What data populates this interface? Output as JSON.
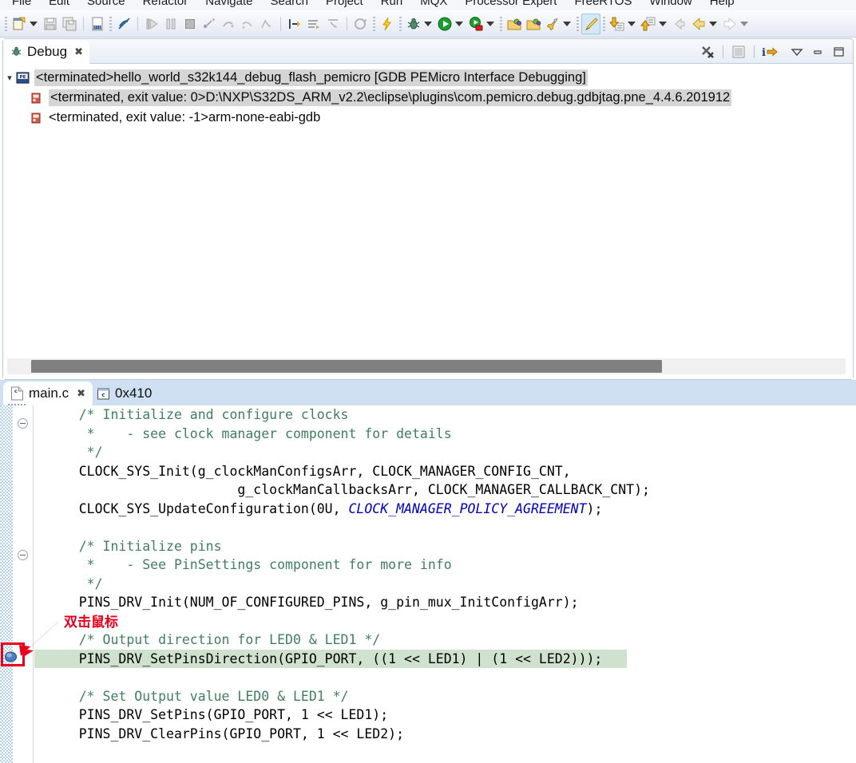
{
  "menu": {
    "items": [
      "File",
      "Edit",
      "Source",
      "Refactor",
      "Navigate",
      "Search",
      "Project",
      "Run",
      "MQX",
      "Processor Expert",
      "FreeRTOS",
      "Window",
      "Help"
    ]
  },
  "toolbar": {
    "icons": [
      "new-file-icon",
      "new-dropdown-caret",
      "save-icon",
      "save-all-icon",
      "build-hex-icon",
      "toggle-link-icon",
      "resume-icon",
      "suspend-icon",
      "terminate-icon",
      "step-into-icon",
      "step-over-icon",
      "step-return-icon",
      "step-instruction-icon",
      "skip-to-line-icon",
      "show-disassembly-icon",
      "instruction-stepping-icon",
      "build-all-icon",
      "build-flash-icon",
      "debug-bug-icon",
      "debug-dropdown-caret",
      "run-icon",
      "run-dropdown-caret",
      "profile-icon",
      "profile-dropdown-caret",
      "open-type-icon",
      "open-resource-icon",
      "launch-icon",
      "launch-dropdown-caret",
      "edit-highlight-icon",
      "next-annotation-icon",
      "next-annotation-caret",
      "previous-annotation-icon",
      "previous-annotation-caret",
      "back-history-icon",
      "back-icon",
      "back-caret",
      "forward-icon",
      "forward-caret"
    ]
  },
  "debug_view": {
    "tab_label": "Debug",
    "tab_icon": "debug-bug-icon",
    "close_icon": "close-icon",
    "tools": [
      {
        "name": "remove-all-terminated-icon",
        "label": "Remove All Terminated Launches"
      },
      {
        "name": "collapse-all-icon",
        "label": "Collapse All"
      },
      {
        "name": "show-details-icon",
        "label": "Show Debug Details"
      },
      {
        "name": "view-menu-icon",
        "label": "View Menu"
      },
      {
        "name": "minimize-icon",
        "label": "Minimize"
      },
      {
        "name": "maximize-icon",
        "label": "Maximize"
      }
    ],
    "tree": {
      "root": {
        "expander": "chevron-down-icon",
        "icon": "pemicro-launch-icon",
        "text": "<terminated>hello_world_s32k144_debug_flash_pemicro [GDB PEMicro Interface Debugging]",
        "selected": true
      },
      "children": [
        {
          "icon": "process-icon",
          "text": "<terminated, exit value: 0>D:\\NXP\\S32DS_ARM_v2.2\\eclipse\\plugins\\com.pemicro.debug.gdbjtag.pne_4.4.6.201912",
          "selected": true
        },
        {
          "icon": "process-icon",
          "text": "<terminated, exit value: -1>arm-none-eabi-gdb",
          "selected": false
        }
      ]
    },
    "hscrollbar": "horizontal-scrollbar"
  },
  "editor": {
    "tabs": [
      {
        "label": "main.c",
        "icon": "c-file-icon",
        "active": true,
        "close_icon": "close-icon"
      },
      {
        "label": "0x410",
        "icon": "disassembly-icon",
        "active": false
      }
    ],
    "code_lines": [
      {
        "fold": true,
        "segments": [
          {
            "t": "    /* Initialize and configure clocks",
            "c": "cmt"
          }
        ]
      },
      {
        "fold": false,
        "segments": [
          {
            "t": "     *    - see clock manager component for details",
            "c": "cmt"
          }
        ]
      },
      {
        "fold": false,
        "segments": [
          {
            "t": "     */",
            "c": "cmt"
          }
        ]
      },
      {
        "fold": false,
        "segments": [
          {
            "t": "    CLOCK_SYS_Init(g_clockManConfigsArr, CLOCK_MANAGER_CONFIG_CNT,",
            "c": ""
          }
        ]
      },
      {
        "fold": false,
        "segments": [
          {
            "t": "                        g_clockManCallbacksArr, CLOCK_MANAGER_CALLBACK_CNT);",
            "c": ""
          }
        ]
      },
      {
        "fold": false,
        "segments": [
          {
            "t": "    CLOCK_SYS_UpdateConfiguration(0U, ",
            "c": ""
          },
          {
            "t": "CLOCK_MANAGER_POLICY_AGREEMENT",
            "c": "field"
          },
          {
            "t": ");",
            "c": ""
          }
        ]
      },
      {
        "fold": false,
        "segments": [
          {
            "t": "",
            "c": ""
          }
        ]
      },
      {
        "fold": true,
        "segments": [
          {
            "t": "    /* Initialize pins",
            "c": "cmt"
          }
        ]
      },
      {
        "fold": false,
        "segments": [
          {
            "t": "     *    - See PinSettings component for more info",
            "c": "cmt"
          }
        ]
      },
      {
        "fold": false,
        "segments": [
          {
            "t": "     */",
            "c": "cmt"
          }
        ]
      },
      {
        "fold": false,
        "segments": [
          {
            "t": "    PINS_DRV_Init(NUM_OF_CONFIGURED_PINS, g_pin_mux_InitConfigArr);",
            "c": ""
          }
        ]
      },
      {
        "fold": false,
        "segments": [
          {
            "t": "",
            "c": ""
          }
        ]
      },
      {
        "fold": false,
        "segments": [
          {
            "t": "    /* Output direction for LED0 & LED1 */",
            "c": "cmt"
          }
        ]
      },
      {
        "fold": false,
        "highlight": true,
        "segments": [
          {
            "t": "    PINS_DRV_SetPinsDirection(GPIO_PORT, ((1 << LED1) | (1 << LED2)));",
            "c": ""
          }
        ]
      },
      {
        "fold": false,
        "segments": [
          {
            "t": "",
            "c": ""
          }
        ]
      },
      {
        "fold": false,
        "segments": [
          {
            "t": "    /* Set Output value LED0 & LED1 */",
            "c": "cmt"
          }
        ]
      },
      {
        "fold": false,
        "segments": [
          {
            "t": "    PINS_DRV_SetPins(GPIO_PORT, 1 << LED1);",
            "c": ""
          }
        ]
      },
      {
        "fold": false,
        "segments": [
          {
            "t": "    PINS_DRV_ClearPins(GPIO_PORT, 1 << LED2);",
            "c": ""
          }
        ]
      }
    ],
    "breakpoint": {
      "icon": "breakpoint-icon",
      "highlight_box": "red-rectangle-highlight"
    }
  },
  "annotation": {
    "text": "双击鼠标",
    "arrow": "red-arrow-icon"
  },
  "colors": {
    "comment_green": "#3f7f5f",
    "field_blue": "#0000c0",
    "annotation_red": "#e8001c",
    "highlight_line": "#cfe2ce",
    "tab_blue": "#cfe0f2",
    "selection_gray": "#d5d5d5"
  }
}
